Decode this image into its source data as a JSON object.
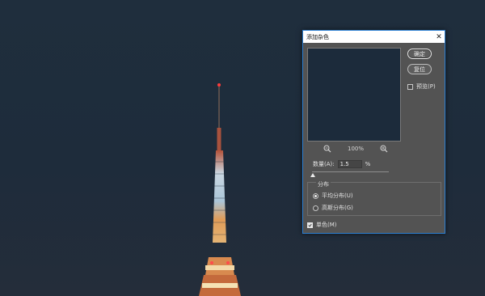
{
  "dialog": {
    "title": "添加杂色",
    "close_glyph": "✕",
    "ok_label": "确定",
    "reset_label": "复位",
    "preview_label": "预览(P)",
    "preview_checked": false,
    "zoom_level": "100%",
    "amount_label": "数量(A):",
    "amount_value": "1.5",
    "amount_unit": "%",
    "distribution_title": "分布",
    "uniform_label": "平均分布(U)",
    "gaussian_label": "高斯分布(G)",
    "selected_distribution": "uniform",
    "monochromatic_label": "单色(M)",
    "monochromatic_checked": true
  },
  "icons": {
    "close": "close-icon",
    "zoom_out": "zoom-out-icon",
    "zoom_in": "zoom-in-icon"
  },
  "colors": {
    "dialog_bg": "#535353",
    "dialog_border": "#2d7fd0",
    "night_sky": "#1f2e3d",
    "preview_bg": "#1c2b3b"
  }
}
